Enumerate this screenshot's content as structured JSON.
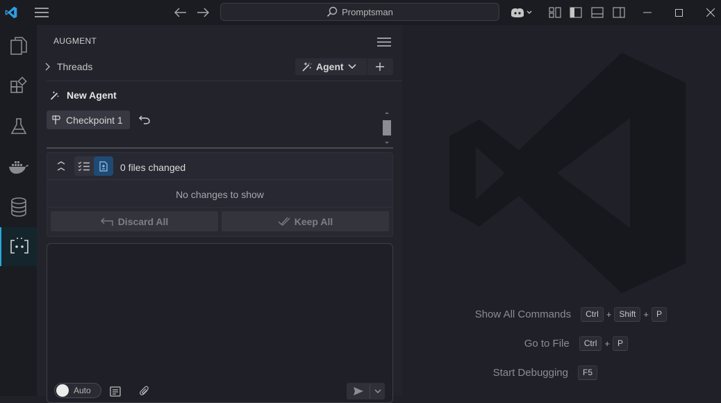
{
  "titlebar": {
    "search_text": "Promptsman"
  },
  "panel": {
    "title": "AUGMENT",
    "threads_label": "Threads",
    "agent_dropdown_label": "Agent",
    "new_agent_label": "New Agent",
    "checkpoint_label": "Checkpoint 1",
    "files_changed_label": "0 files changed",
    "no_changes_label": "No changes to show",
    "discard_label": "Discard All",
    "keep_label": "Keep All",
    "auto_toggle_label": "Auto"
  },
  "editor": {
    "shortcuts": [
      {
        "label": "Show All Commands",
        "keys": [
          "Ctrl",
          "Shift",
          "P"
        ]
      },
      {
        "label": "Go to File",
        "keys": [
          "Ctrl",
          "P"
        ]
      },
      {
        "label": "Start Debugging",
        "keys": [
          "F5"
        ]
      }
    ]
  },
  "colors": {
    "accent": "#2aa9d8",
    "titlebar_bg": "#1b1c22",
    "panel_bg": "#22232b",
    "editor_bg": "#1f2028"
  }
}
